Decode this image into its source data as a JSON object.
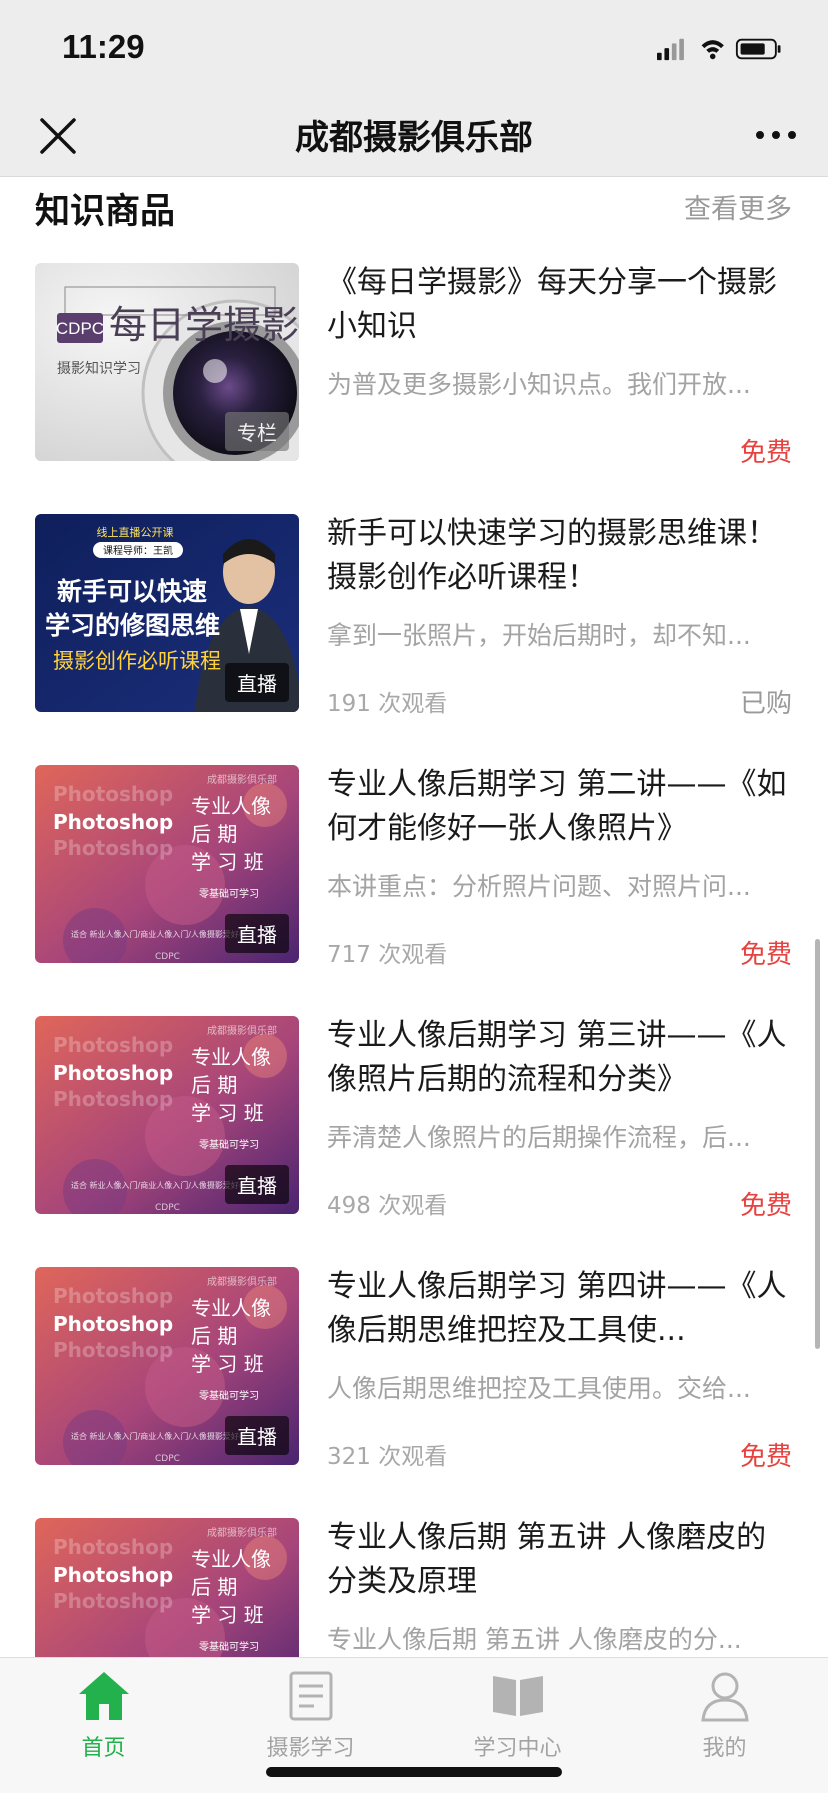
{
  "status_bar": {
    "time": "11:29"
  },
  "nav": {
    "title": "成都摄影俱乐部",
    "close_icon": "close-icon",
    "more_icon": "more-icon"
  },
  "section": {
    "title": "知识商品",
    "more": "查看更多"
  },
  "items": [
    {
      "title": "《每日学摄影》每天分享一个摄影小知识",
      "desc": "为普及更多摄影小知识点。我们开放...",
      "views": "",
      "price": "免费",
      "tag": "专栏",
      "thumb": {
        "style": "lens",
        "brand": "CDPC",
        "headline": "每日学摄影",
        "sub": "摄影知识学习"
      }
    },
    {
      "title": "新手可以快速学习的摄影思维课！摄影创作必听课程！",
      "desc": "拿到一张照片，开始后期时，却不知...",
      "views": "191 次观看",
      "price": "已购",
      "tag": "直播",
      "thumb": {
        "style": "live",
        "top1": "线上直播公开课",
        "top2": "课程导师：王凯",
        "line1": "新手可以快速",
        "line2": "学习的修图思维",
        "line3": "摄影创作必听课程"
      }
    },
    {
      "title": "专业人像后期学习 第二讲——《如何才能修好一张人像照片》",
      "desc": "本讲重点：分析照片问题、对照片问...",
      "views": "717 次观看",
      "price": "免费",
      "tag": "直播",
      "thumb": {
        "style": "ps",
        "ps": "Photoshop",
        "club": "成都摄影俱乐部",
        "l1": "专业人像",
        "l2": "后 期",
        "l3": "学 习 班",
        "sub": "零基础可学习",
        "foot": "适合 新业人像入门/商业人像入门/人像摄影爱好者",
        "logo": "CDPC"
      }
    },
    {
      "title": "专业人像后期学习 第三讲——《人像照片后期的流程和分类》",
      "desc": "弄清楚人像照片的后期操作流程，后...",
      "views": "498 次观看",
      "price": "免费",
      "tag": "直播",
      "thumb": {
        "style": "ps",
        "ps": "Photoshop",
        "club": "成都摄影俱乐部",
        "l1": "专业人像",
        "l2": "后 期",
        "l3": "学 习 班",
        "sub": "零基础可学习",
        "foot": "适合 新业人像入门/商业人像入门/人像摄影爱好者",
        "logo": "CDPC"
      }
    },
    {
      "title": "专业人像后期学习 第四讲——《人像后期思维把控及工具使...",
      "desc": "人像后期思维把控及工具使用。交给...",
      "views": "321 次观看",
      "price": "免费",
      "tag": "直播",
      "thumb": {
        "style": "ps",
        "ps": "Photoshop",
        "club": "成都摄影俱乐部",
        "l1": "专业人像",
        "l2": "后 期",
        "l3": "学 习 班",
        "sub": "零基础可学习",
        "foot": "适合 新业人像入门/商业人像入门/人像摄影爱好者",
        "logo": "CDPC"
      }
    },
    {
      "title": "专业人像后期 第五讲 人像磨皮的分类及原理",
      "desc": "专业人像后期 第五讲 人像磨皮的分...",
      "views": "",
      "price": "",
      "tag": "",
      "thumb": {
        "style": "ps",
        "ps": "Photoshop",
        "club": "成都摄影俱乐部",
        "l1": "专业人像",
        "l2": "后 期",
        "l3": "学 习 班",
        "sub": "零基础可学习",
        "foot": "",
        "logo": ""
      }
    }
  ],
  "tabs": [
    {
      "label": "首页",
      "icon": "home-icon",
      "active": true
    },
    {
      "label": "摄影学习",
      "icon": "notes-icon",
      "active": false
    },
    {
      "label": "学习中心",
      "icon": "book-icon",
      "active": false
    },
    {
      "label": "我的",
      "icon": "profile-icon",
      "active": false
    }
  ],
  "colors": {
    "accent_green": "#22b14c",
    "price_red": "#e64340",
    "bar_bg": "#ededed"
  }
}
